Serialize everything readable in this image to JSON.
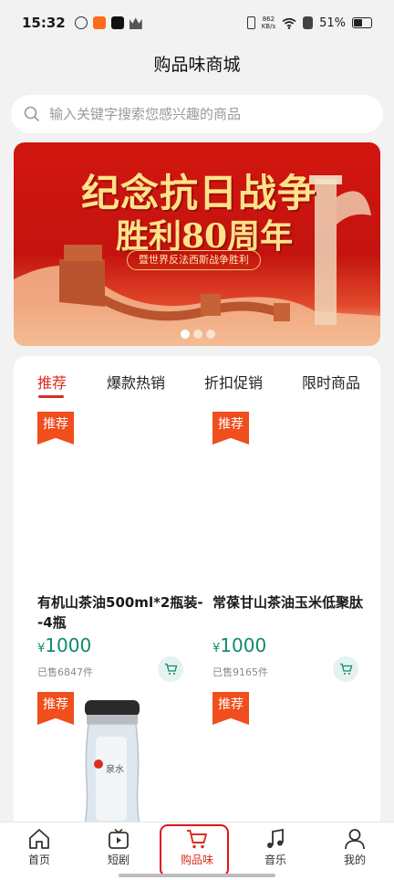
{
  "status_bar": {
    "time": "15:32",
    "net_speed_value": "862",
    "net_speed_unit": "KB/s",
    "battery": "51%"
  },
  "page": {
    "title": "购品味商城"
  },
  "search": {
    "placeholder": "输入关键字搜索您感兴趣的商品"
  },
  "banner": {
    "line1": "纪念抗日战争",
    "line2": "胜利80周年",
    "sub": "暨世界反法西斯战争胜利",
    "slide_count": 3,
    "active_slide": 0
  },
  "tabs": [
    {
      "label": "推荐",
      "active": true
    },
    {
      "label": "爆款热销",
      "active": false
    },
    {
      "label": "折扣促销",
      "active": false
    },
    {
      "label": "限时商品",
      "active": false
    }
  ],
  "products": [
    {
      "badge": "推荐",
      "name": "有机山茶油500ml*2瓶装--4瓶",
      "currency": "¥",
      "price": "1000",
      "sold": "已售6847件"
    },
    {
      "badge": "推荐",
      "name": "常葆甘山茶油玉米低聚肽",
      "currency": "¥",
      "price": "1000",
      "sold": "已售9165件"
    },
    {
      "badge": "推荐",
      "bottle_label": "泉水"
    },
    {
      "badge": "推荐"
    }
  ],
  "bottom_nav": [
    {
      "label": "首页",
      "icon": "home-icon"
    },
    {
      "label": "短剧",
      "icon": "tv-play-icon"
    },
    {
      "label": "购品味",
      "icon": "cart-icon",
      "active": true
    },
    {
      "label": "音乐",
      "icon": "music-note-icon"
    },
    {
      "label": "我的",
      "icon": "person-icon"
    }
  ],
  "colors": {
    "accent_red": "#d92d20",
    "price_green": "#0f8a6a",
    "badge_orange": "#f04e1d",
    "nav_highlight": "#e0141e"
  }
}
